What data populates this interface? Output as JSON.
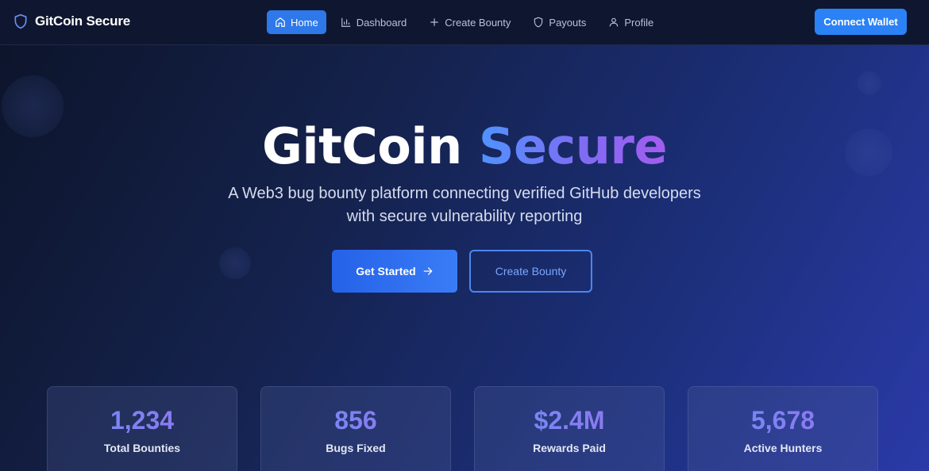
{
  "brand": {
    "name": "GitCoin Secure",
    "icon": "shield-icon"
  },
  "nav": {
    "items": [
      {
        "label": "Home",
        "icon": "home-icon",
        "active": true
      },
      {
        "label": "Dashboard",
        "icon": "bar-chart-icon",
        "active": false
      },
      {
        "label": "Create Bounty",
        "icon": "plus-icon",
        "active": false
      },
      {
        "label": "Payouts",
        "icon": "shield-icon",
        "active": false
      },
      {
        "label": "Profile",
        "icon": "user-icon",
        "active": false
      }
    ],
    "connect_label": "Connect Wallet"
  },
  "hero": {
    "title_part1": "GitCoin",
    "title_part2": "Secure",
    "subtitle_line1": "A Web3 bug bounty platform connecting verified GitHub developers",
    "subtitle_line2": "with secure vulnerability reporting",
    "primary_label": "Get Started",
    "secondary_label": "Create Bounty"
  },
  "stats": [
    {
      "value": "1,234",
      "label": "Total Bounties"
    },
    {
      "value": "856",
      "label": "Bugs Fixed"
    },
    {
      "value": "$2.4M",
      "label": "Rewards Paid"
    },
    {
      "value": "5,678",
      "label": "Active Hunters"
    }
  ],
  "colors": {
    "accent": "#2b82f6",
    "gradient_start": "#4f93ff",
    "gradient_end": "#a45cf0"
  }
}
